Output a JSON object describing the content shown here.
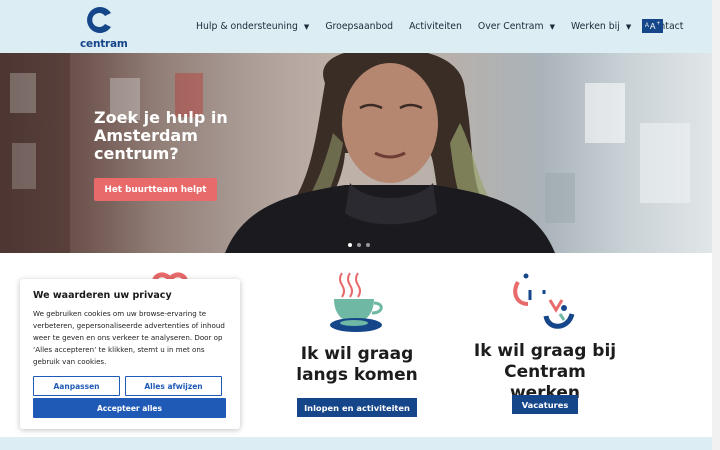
{
  "header": {
    "logo_text": "centram",
    "nav": [
      {
        "label": "Hulp & ondersteuning",
        "has_dropdown": true
      },
      {
        "label": "Groepsaanbod",
        "has_dropdown": false
      },
      {
        "label": "Activiteiten",
        "has_dropdown": false
      },
      {
        "label": "Over Centram",
        "has_dropdown": true
      },
      {
        "label": "Werken bij",
        "has_dropdown": true
      },
      {
        "label": "Contact",
        "has_dropdown": false
      }
    ],
    "font_size_button": {
      "small": "A",
      "large": "A",
      "plus": "+"
    }
  },
  "hero": {
    "title": "Zoek je hulp in Amsterdam centrum?",
    "button": "Het buurtteam helpt",
    "slides": 3,
    "active_slide": 1
  },
  "cards": [
    {
      "title": "Ik wil graag langs komen",
      "button": "Inlopen en activiteiten",
      "icon": "coffee-cup-icon"
    },
    {
      "title": "Ik wil graag bij Centram werken",
      "button": "Vacatures",
      "icon": "smiley-face-icon"
    }
  ],
  "cookie": {
    "title": "We waarderen uw privacy",
    "text": "We gebruiken cookies om uw browse-ervaring te verbeteren, gepersonaliseerde advertenties of inhoud weer te geven en ons verkeer te analyseren. Door op ‘Alles accepteren’ te klikken, stemt u in met ons gebruik van cookies.",
    "customize": "Aanpassen",
    "reject": "Alles afwijzen",
    "accept": "Accepteer alles"
  },
  "colors": {
    "brand_blue": "#16468a",
    "header_bg": "#dcedf3",
    "coral": "#e86a6a",
    "cookie_blue": "#1f5ab6",
    "teal": "#6fb8a4"
  }
}
